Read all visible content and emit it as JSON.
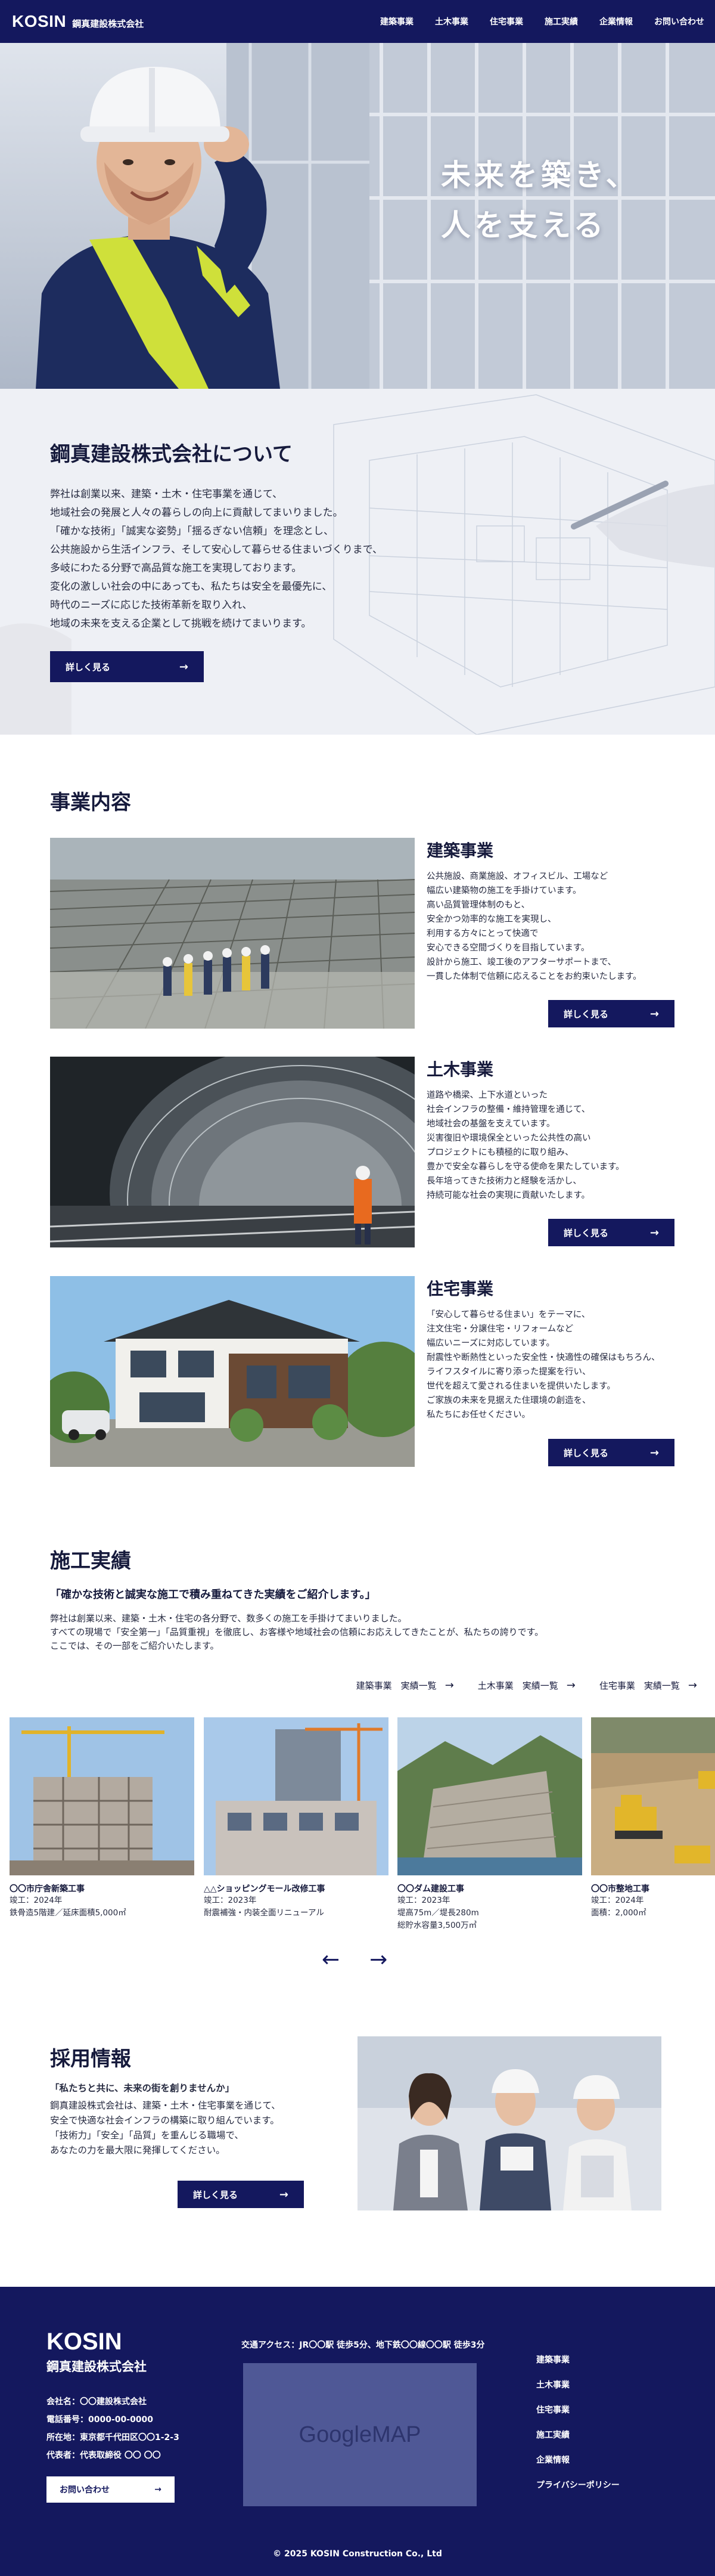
{
  "header": {
    "logo_en": "KOSIN",
    "logo_jp": "鋼真建設株式会社",
    "nav": [
      "建築事業",
      "土木事業",
      "住宅事業",
      "施工実績",
      "企業情報",
      "お問い合わせ"
    ]
  },
  "hero": {
    "copy_line1": "未来を築き、",
    "copy_line2": "人を支える"
  },
  "about": {
    "title": "鋼真建設株式会社について",
    "lines": [
      "弊社は創業以来、建築・土木・住宅事業を通じて、",
      "地域社会の発展と人々の暮らしの向上に貢献してまいりました。",
      "「確かな技術」「誠実な姿勢」「揺るぎない信頼」を理念とし、",
      "公共施設から生活インフラ、そして安心して暮らせる住まいづくりまで、",
      "多岐にわたる分野で高品質な施工を実現しております。",
      "変化の激しい社会の中にあっても、私たちは安全を最優先に、",
      "時代のニーズに応じた技術革新を取り入れ、",
      "地域の未来を支える企業として挑戦を続けてまいります。"
    ],
    "button": "詳しく見る",
    "arrow": "→"
  },
  "services": {
    "title": "事業内容",
    "items": [
      {
        "title": "建築事業",
        "lines": [
          "公共施設、商業施設、オフィスビル、工場など",
          "幅広い建築物の施工を手掛けています。",
          "高い品質管理体制のもと、",
          "安全かつ効率的な施工を実現し、",
          "利用する方々にとって快適で",
          "安心できる空間づくりを目指しています。",
          "設計から施工、竣工後のアフターサポートまで、",
          "一貫した体制で信頼に応えることをお約束いたします。"
        ],
        "button": "詳しく見る"
      },
      {
        "title": "土木事業",
        "lines": [
          "道路や橋梁、上下水道といった",
          "社会インフラの整備・維持管理を通じて、",
          "地域社会の基盤を支えています。",
          "災害復旧や環境保全といった公共性の高い",
          "プロジェクトにも積極的に取り組み、",
          "豊かで安全な暮らしを守る使命を果たしています。",
          "長年培ってきた技術力と経験を活かし、",
          "持続可能な社会の実現に貢献いたします。"
        ],
        "button": "詳しく見る"
      },
      {
        "title": "住宅事業",
        "lines": [
          "「安心して暮らせる住まい」をテーマに、",
          "注文住宅・分譲住宅・リフォームなど",
          "幅広いニーズに対応しています。",
          "耐震性や断熱性といった安全性・快適性の確保はもちろん、",
          "ライフスタイルに寄り添った提案を行い、",
          "世代を超えて愛される住まいを提供いたします。",
          "ご家族の未来を見据えた住環境の創造を、",
          "私たちにお任せください。"
        ],
        "button": "詳しく見る"
      }
    ]
  },
  "works": {
    "title": "施工実績",
    "lead": "「確かな技術と誠実な施工で積み重ねてきた実績をご紹介します。」",
    "lines": [
      "弊社は創業以来、建築・土木・住宅の各分野で、数多くの施工を手掛けてまいりました。",
      "すべての現場で「安全第一」「品質重視」を徹底し、お客様や地域社会の信頼にお応えしてきたことが、私たちの誇りです。",
      "ここでは、その一部をご紹介いたします。"
    ],
    "links": [
      "建築事業　実績一覧",
      "土木事業　実績一覧",
      "住宅事業　実績一覧"
    ],
    "cards": [
      {
        "name": "〇〇市庁舎新築工事",
        "info": [
          "竣工：2024年",
          "鉄骨造5階建／延床面積5,000㎡"
        ]
      },
      {
        "name": "△△ショッピングモール改修工事",
        "info": [
          "竣工：2023年",
          "耐震補強・内装全面リニューアル"
        ]
      },
      {
        "name": "〇〇ダム建設工事",
        "info": [
          "竣工：2023年",
          "堤高75m／堤長280m",
          "総貯水容量3,500万㎥"
        ]
      },
      {
        "name": "〇〇市整地工事",
        "info": [
          "竣工：2024年",
          "面積：2,000㎡"
        ]
      }
    ],
    "prev": "←",
    "next": "→"
  },
  "recruit": {
    "title": "採用情報",
    "lines": [
      "「私たちと共に、未来の街を創りませんか」",
      "鋼真建設株式会社は、建築・土木・住宅事業を通じて、",
      "安全で快適な社会インフラの構築に取り組んでいます。",
      "「技術力」「安全」「品質」を重んじる職場で、",
      "あなたの力を最大限に発揮してください。"
    ],
    "button": "詳しく見る"
  },
  "footer": {
    "logo_en": "KOSIN",
    "logo_jp": "鋼真建設株式会社",
    "info": [
      "会社名：〇〇建設株式会社",
      "電話番号：0000-00-0000",
      "所在地：東京都千代田区〇〇1-2-3",
      "代表者：代表取締役 〇〇 〇〇"
    ],
    "contact_button": "お問い合わせ",
    "access": "交通アクセス：JR〇〇駅 徒歩5分、地下鉄〇〇線〇〇駅 徒歩3分",
    "map_label": "GoogleMAP",
    "nav": [
      "建築事業",
      "土木事業",
      "住宅事業",
      "施工実績",
      "企業情報",
      "プライバシーポリシー"
    ],
    "copyright": "© 2025 KOSIN Construction Co., Ltd"
  },
  "colors": {
    "navy": "#14185e",
    "light_bg": "#eef0f5",
    "map": "#4f5896"
  }
}
